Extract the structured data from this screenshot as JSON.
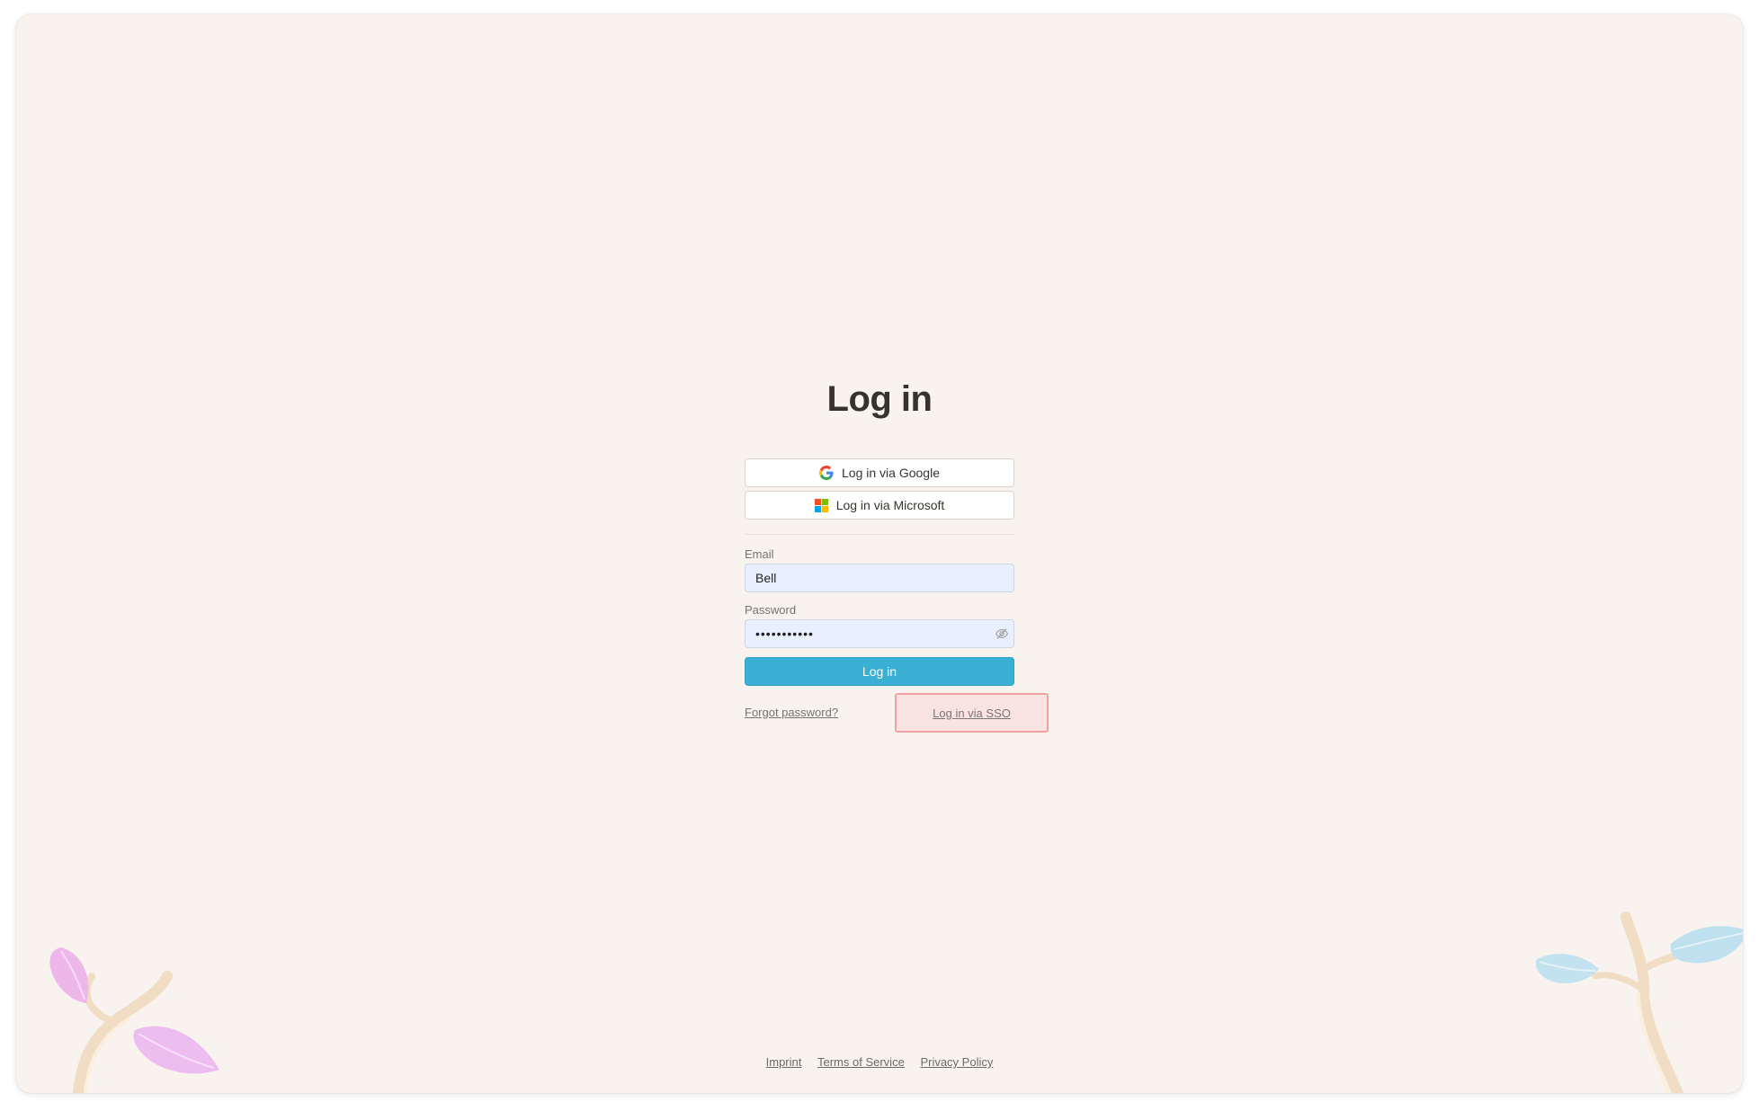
{
  "login": {
    "title": "Log in",
    "google_label": "Log in via Google",
    "microsoft_label": "Log in via Microsoft",
    "email_label": "Email",
    "email_value": "Bell",
    "password_label": "Password",
    "password_value": "•••••••••••",
    "submit_label": "Log in",
    "forgot_label": "Forgot password?",
    "sso_label": "Log in via SSO"
  },
  "footer": {
    "links": [
      "Imprint",
      "Terms of Service",
      "Privacy Policy"
    ]
  },
  "icons": {
    "google": "google-logo-icon",
    "microsoft": "microsoft-logo-icon",
    "password_toggle": "eye-slash-icon"
  },
  "colors": {
    "background": "#f8f3ef",
    "primary_button": "#39b0d4",
    "input_fill": "#e8efff",
    "sso_highlight_fill": "#fae4e2",
    "sso_highlight_border": "#f0a1a0",
    "microsoft_logo": [
      "#f25022",
      "#7fba00",
      "#00a4ef",
      "#ffb900"
    ]
  }
}
